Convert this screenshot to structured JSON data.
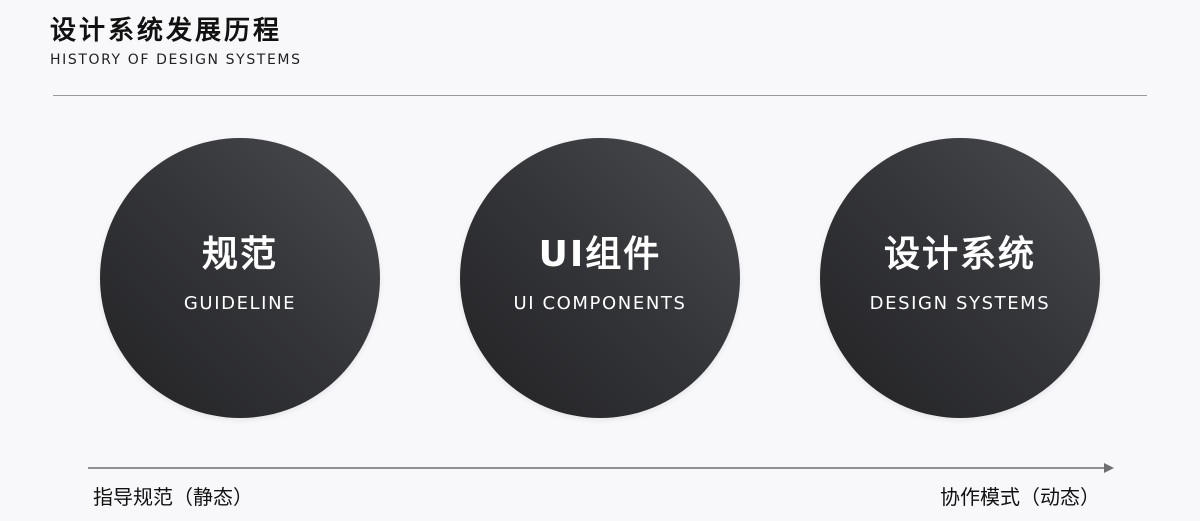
{
  "header": {
    "title": "设计系统发展历程",
    "subtitle": "HISTORY OF DESIGN SYSTEMS"
  },
  "stages": [
    {
      "title": "规范",
      "subtitle": "GUIDELINE"
    },
    {
      "title": "UI组件",
      "subtitle": "UI COMPONENTS"
    },
    {
      "title": "设计系统",
      "subtitle": "DESIGN SYSTEMS"
    }
  ],
  "axis": {
    "start_label": "指导规范（静态）",
    "end_label": "协作模式（动态）"
  },
  "colors": {
    "background": "#f8f8fa",
    "circle_dark": "#222224",
    "circle_light": "#4a4b4f",
    "text_light": "#ffffff",
    "axis": "#6e6e72"
  }
}
